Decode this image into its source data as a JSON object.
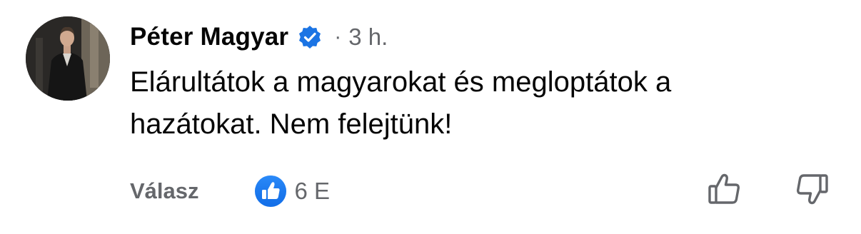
{
  "comment": {
    "author": "Péter Magyar",
    "verified_icon": "verified-badge-icon",
    "separator": "·",
    "time": "3 h.",
    "text": "Elárultátok a magyarokat és megloptátok a\nhazátokat. Nem felejtünk!",
    "avatar_icon": "user-photo-avatar"
  },
  "actions": {
    "reply_label": "Válasz",
    "reaction_icon": "like-reaction-icon",
    "reaction_count": "6 E",
    "upvote_icon": "thumbs-up-outline-icon",
    "downvote_icon": "thumbs-down-outline-icon"
  },
  "colors": {
    "text_primary": "#050505",
    "text_secondary": "#65676b",
    "facebook_blue": "#1877f2",
    "verified_blue": "#1b74e4"
  }
}
